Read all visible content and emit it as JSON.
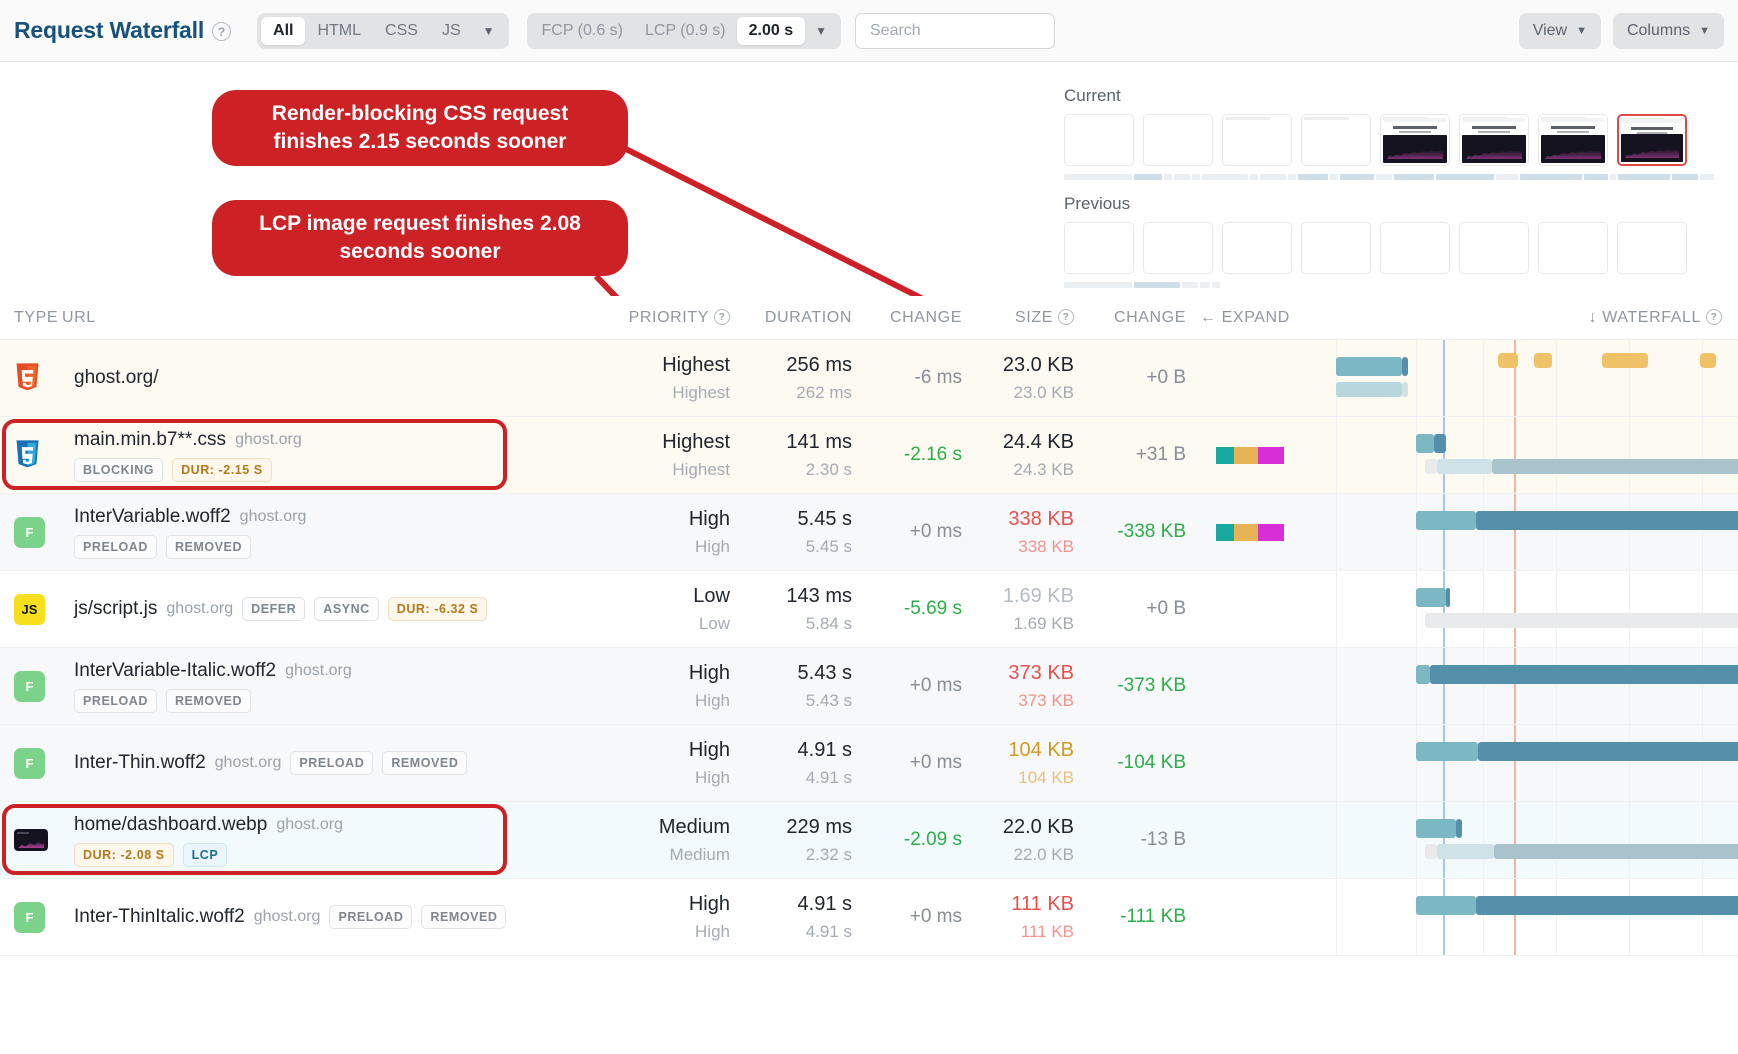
{
  "header": {
    "title": "Request Waterfall",
    "help_icon": "help-circle-icon",
    "filters": [
      {
        "label": "All",
        "active": true
      },
      {
        "label": "HTML",
        "active": false
      },
      {
        "label": "CSS",
        "active": false
      },
      {
        "label": "JS",
        "active": false
      },
      {
        "label": "▼",
        "active": false
      }
    ],
    "metrics": [
      {
        "label": "FCP (0.6 s)",
        "active": false
      },
      {
        "label": "LCP (0.9 s)",
        "active": false
      },
      {
        "label": "2.00 s",
        "active": true
      },
      {
        "label": "▼",
        "active": false
      }
    ],
    "search": {
      "value": "",
      "placeholder": "Search"
    },
    "view_button": "View",
    "columns_button": "Columns",
    "caret": "▼"
  },
  "filmstrip": {
    "current_label": "Current",
    "previous_label": "Previous",
    "axis_ticks": [
      "0 s",
      "0.5 s",
      "1.0 s",
      "1.5 s",
      "2.0 s"
    ],
    "current_frames": 8,
    "previous_frames": 8,
    "current_selected_index": 7
  },
  "callouts": [
    {
      "id": "callout-1",
      "text": "Render-blocking CSS request finishes 2.15 seconds sooner"
    },
    {
      "id": "callout-2",
      "text": "LCP image request finishes 2.08 seconds sooner"
    }
  ],
  "table": {
    "columns": {
      "type": "TYPE",
      "url": "URL",
      "priority": "PRIORITY",
      "duration": "DURATION",
      "change1": "CHANGE",
      "size": "SIZE",
      "change2": "CHANGE",
      "expand": "← EXPAND",
      "waterfall": "↓ WATERFALL"
    },
    "rows": [
      {
        "icon": "html5-icon",
        "name": "ghost.org/",
        "host": "",
        "tags": [],
        "priority": "Highest",
        "priority_prev": "Highest",
        "duration": "256 ms",
        "duration_prev": "262 ms",
        "change_time": "-6 ms",
        "size": "23.0 KB",
        "size_prev": "23.0 KB",
        "change_size": "+0 B",
        "highlighted": false
      },
      {
        "icon": "css3-icon",
        "name": "main.min.b7**.css",
        "host": "ghost.org",
        "tags": [
          "BLOCKING",
          "DUR: -2.15 S"
        ],
        "priority": "Highest",
        "priority_prev": "Highest",
        "duration": "141 ms",
        "duration_prev": "2.30 s",
        "change_time": "-2.16 s",
        "size": "24.4 KB",
        "size_prev": "24.3 KB",
        "change_size": "+31 B",
        "highlighted": true
      },
      {
        "icon": "font-icon",
        "name": "InterVariable.woff2",
        "host": "ghost.org",
        "tags": [
          "PRELOAD",
          "REMOVED"
        ],
        "priority": "High",
        "priority_prev": "High",
        "duration": "5.45 s",
        "duration_prev": "5.45 s",
        "change_time": "+0 ms",
        "size": "338 KB",
        "size_prev": "338 KB",
        "change_size": "-338 KB",
        "highlighted": false
      },
      {
        "icon": "js-icon",
        "name": "js/script.js",
        "host": "ghost.org",
        "tags": [
          "DEFER",
          "ASYNC",
          "DUR: -6.32 S"
        ],
        "priority": "Low",
        "priority_prev": "Low",
        "duration": "143 ms",
        "duration_prev": "5.84 s",
        "change_time": "-5.69 s",
        "size": "1.69 KB",
        "size_prev": "1.69 KB",
        "change_size": "+0 B",
        "highlighted": false
      },
      {
        "icon": "font-icon",
        "name": "InterVariable-Italic.woff2",
        "host": "ghost.org",
        "tags": [
          "PRELOAD",
          "REMOVED"
        ],
        "priority": "High",
        "priority_prev": "High",
        "duration": "5.43 s",
        "duration_prev": "5.43 s",
        "change_time": "+0 ms",
        "size": "373 KB",
        "size_prev": "373 KB",
        "change_size": "-373 KB",
        "highlighted": false
      },
      {
        "icon": "font-icon",
        "name": "Inter-Thin.woff2",
        "host": "ghost.org",
        "tags": [
          "PRELOAD",
          "REMOVED"
        ],
        "priority": "High",
        "priority_prev": "High",
        "duration": "4.91 s",
        "duration_prev": "4.91 s",
        "change_time": "+0 ms",
        "size": "104 KB",
        "size_prev": "104 KB",
        "change_size": "-104 KB",
        "highlighted": false
      },
      {
        "icon": "image-icon",
        "name": "home/dashboard.webp",
        "host": "ghost.org",
        "tags": [
          "DUR: -2.08 S",
          "LCP"
        ],
        "priority": "Medium",
        "priority_prev": "Medium",
        "duration": "229 ms",
        "duration_prev": "2.32 s",
        "change_time": "-2.09 s",
        "size": "22.0 KB",
        "size_prev": "22.0 KB",
        "change_size": "-13 B",
        "highlighted": true
      },
      {
        "icon": "font-icon",
        "name": "Inter-ThinItalic.woff2",
        "host": "ghost.org",
        "tags": [
          "PRELOAD",
          "REMOVED"
        ],
        "priority": "High",
        "priority_prev": "High",
        "duration": "4.91 s",
        "duration_prev": "4.91 s",
        "change_time": "+0 ms",
        "size": "111 KB",
        "size_prev": "111 KB",
        "change_size": "-111 KB",
        "highlighted": false
      }
    ]
  },
  "colors": {
    "accent_red": "#cc2226",
    "brand_blue": "#16527a",
    "good_green": "#2bae4a",
    "bad_red": "#e8504c",
    "warn_amber": "#d09a22",
    "bar_teal": "#7cb8c4",
    "bar_teal_dark": "#5590ab",
    "highlight_row": "#f2fafd"
  }
}
